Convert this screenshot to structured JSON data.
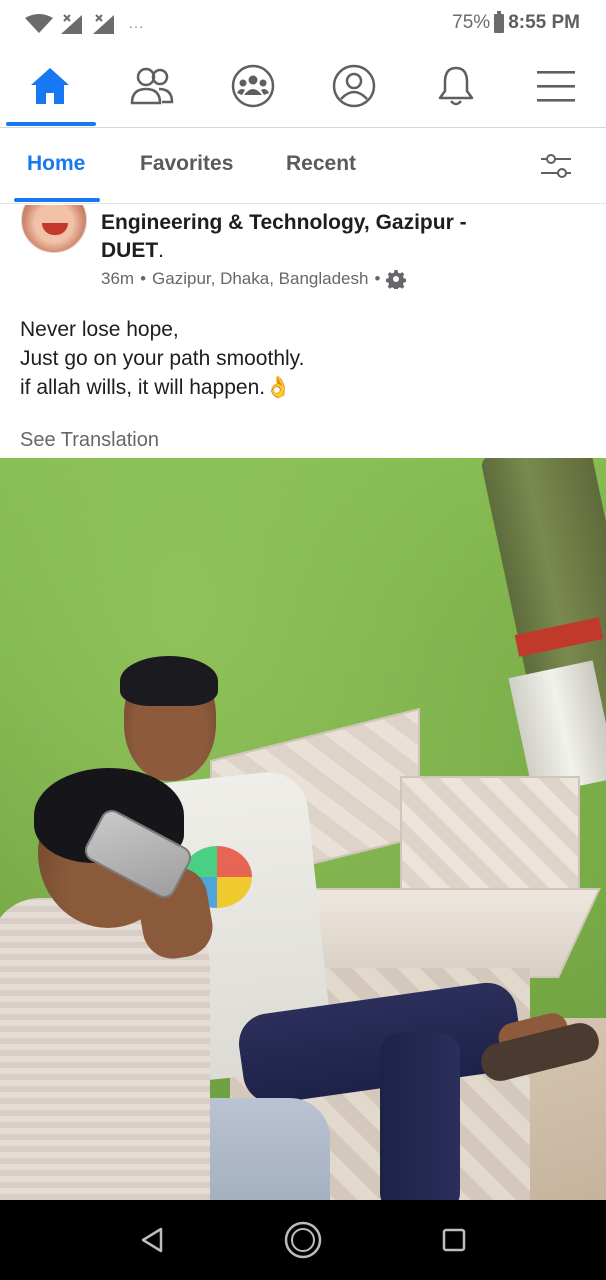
{
  "status_bar": {
    "battery_percent": "75%",
    "time": "8:55 PM",
    "more_indicator": "…"
  },
  "top_nav": {
    "items": [
      {
        "icon": "home-icon",
        "active": true
      },
      {
        "icon": "friends-icon",
        "active": false
      },
      {
        "icon": "groups-icon",
        "active": false
      },
      {
        "icon": "profile-icon",
        "active": false
      },
      {
        "icon": "notifications-bell-icon",
        "active": false
      },
      {
        "icon": "menu-icon",
        "active": false
      }
    ],
    "accent_color": "#1877f2"
  },
  "sub_tabs": {
    "home": "Home",
    "favorites": "Favorites",
    "recent": "Recent"
  },
  "post": {
    "header_line1": "Engineering & Technology, Gazipur -",
    "header_line2": "DUET",
    "header_period": ".",
    "time": "36m",
    "separator": "•",
    "location": "Gazipur, Dhaka, Bangladesh",
    "body_line1": "Never lose hope,",
    "body_line2": "Just go on your path smoothly.",
    "body_line3": "if allah wills, it will happen.",
    "body_emoji": "👌",
    "see_translation": "See Translation"
  }
}
